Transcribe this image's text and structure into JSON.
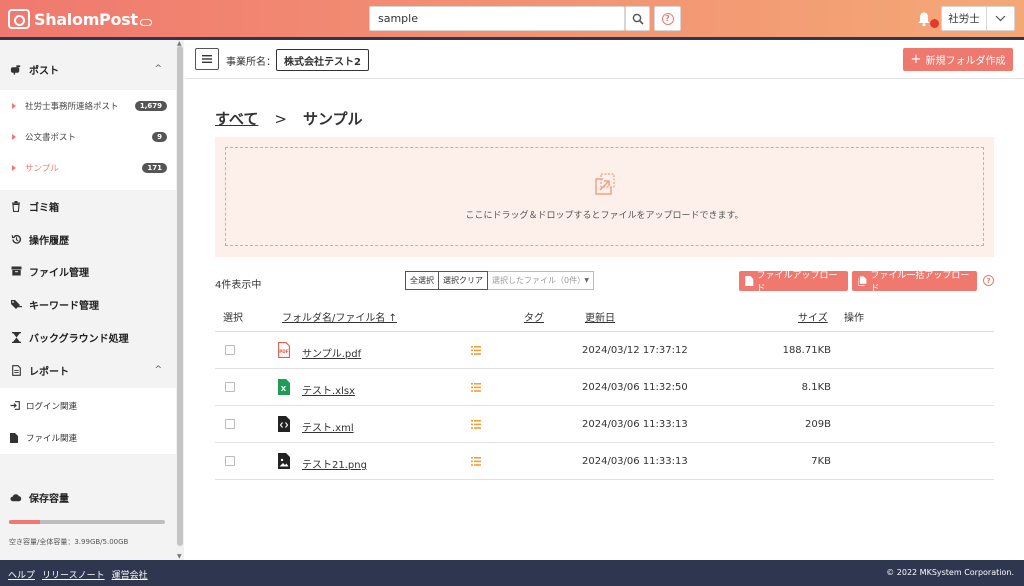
{
  "header": {
    "app_name": "ShalomPost",
    "search_value": "sample",
    "user_label": "社労士"
  },
  "topbar": {
    "office_label": "事業所名：",
    "office_name": "株式会社テスト2",
    "new_folder_label": "新規フォルダ作成"
  },
  "sidebar": {
    "post_section": "ポスト",
    "post_items": [
      {
        "label": "社労士事務所連絡ポスト",
        "count": "1,679"
      },
      {
        "label": "公文書ポスト",
        "count": "9"
      },
      {
        "label": "サンプル",
        "count": "171"
      }
    ],
    "sections": [
      {
        "label": "ゴミ箱",
        "icon": "trash-icon"
      },
      {
        "label": "操作履歴",
        "icon": "history-icon"
      },
      {
        "label": "ファイル管理",
        "icon": "archive-icon"
      },
      {
        "label": "キーワード管理",
        "icon": "tag-key-icon"
      },
      {
        "label": "バックグラウンド処理",
        "icon": "hourglass-icon"
      }
    ],
    "report_section": "レポート",
    "report_items": [
      {
        "label": "ログイン関連",
        "icon": "login-icon"
      },
      {
        "label": "ファイル関連",
        "icon": "file-icon"
      }
    ],
    "storage_label": "保存容量",
    "storage_text": "空き容量/全体容量：3.99GB/5.00GB",
    "storage_used_fraction": 0.2
  },
  "breadcrumb": {
    "root": "すべて",
    "separator": ">",
    "current": "サンプル"
  },
  "dropzone": {
    "text": "ここにドラッグ＆ドロップするとファイルをアップロードできます。"
  },
  "toolbar": {
    "count_text": "4件表示中",
    "select_all": "全選択",
    "clear_selection": "選択クリア",
    "selected_files": "選択したファイル（0件）",
    "upload_file": "ファイルアップロード",
    "bulk_upload": "ファイル一括アップロード"
  },
  "table": {
    "headers": {
      "select": "選択",
      "name": "フォルダ名/ファイル名 ↑",
      "tag": "タグ",
      "updated": "更新日",
      "size": "サイズ",
      "actions": "操作"
    },
    "rows": [
      {
        "name": "サンプル.pdf",
        "type": "pdf",
        "updated": "2024/03/12 17:37:12",
        "size": "188.71KB"
      },
      {
        "name": "テスト.xlsx",
        "type": "xlsx",
        "updated": "2024/03/06 11:32:50",
        "size": "8.1KB"
      },
      {
        "name": "テスト.xml",
        "type": "xml",
        "updated": "2024/03/06 11:33:13",
        "size": "209B"
      },
      {
        "name": "テスト21.png",
        "type": "png",
        "updated": "2024/03/06 11:33:13",
        "size": "7KB"
      }
    ]
  },
  "footer": {
    "links": [
      "ヘルプ",
      "リリースノート",
      "運営会社"
    ],
    "copyright": "© 2022 MKSystem Corporation."
  },
  "colors": {
    "accent": "#f0796f",
    "header_dark": "#2f3650"
  }
}
